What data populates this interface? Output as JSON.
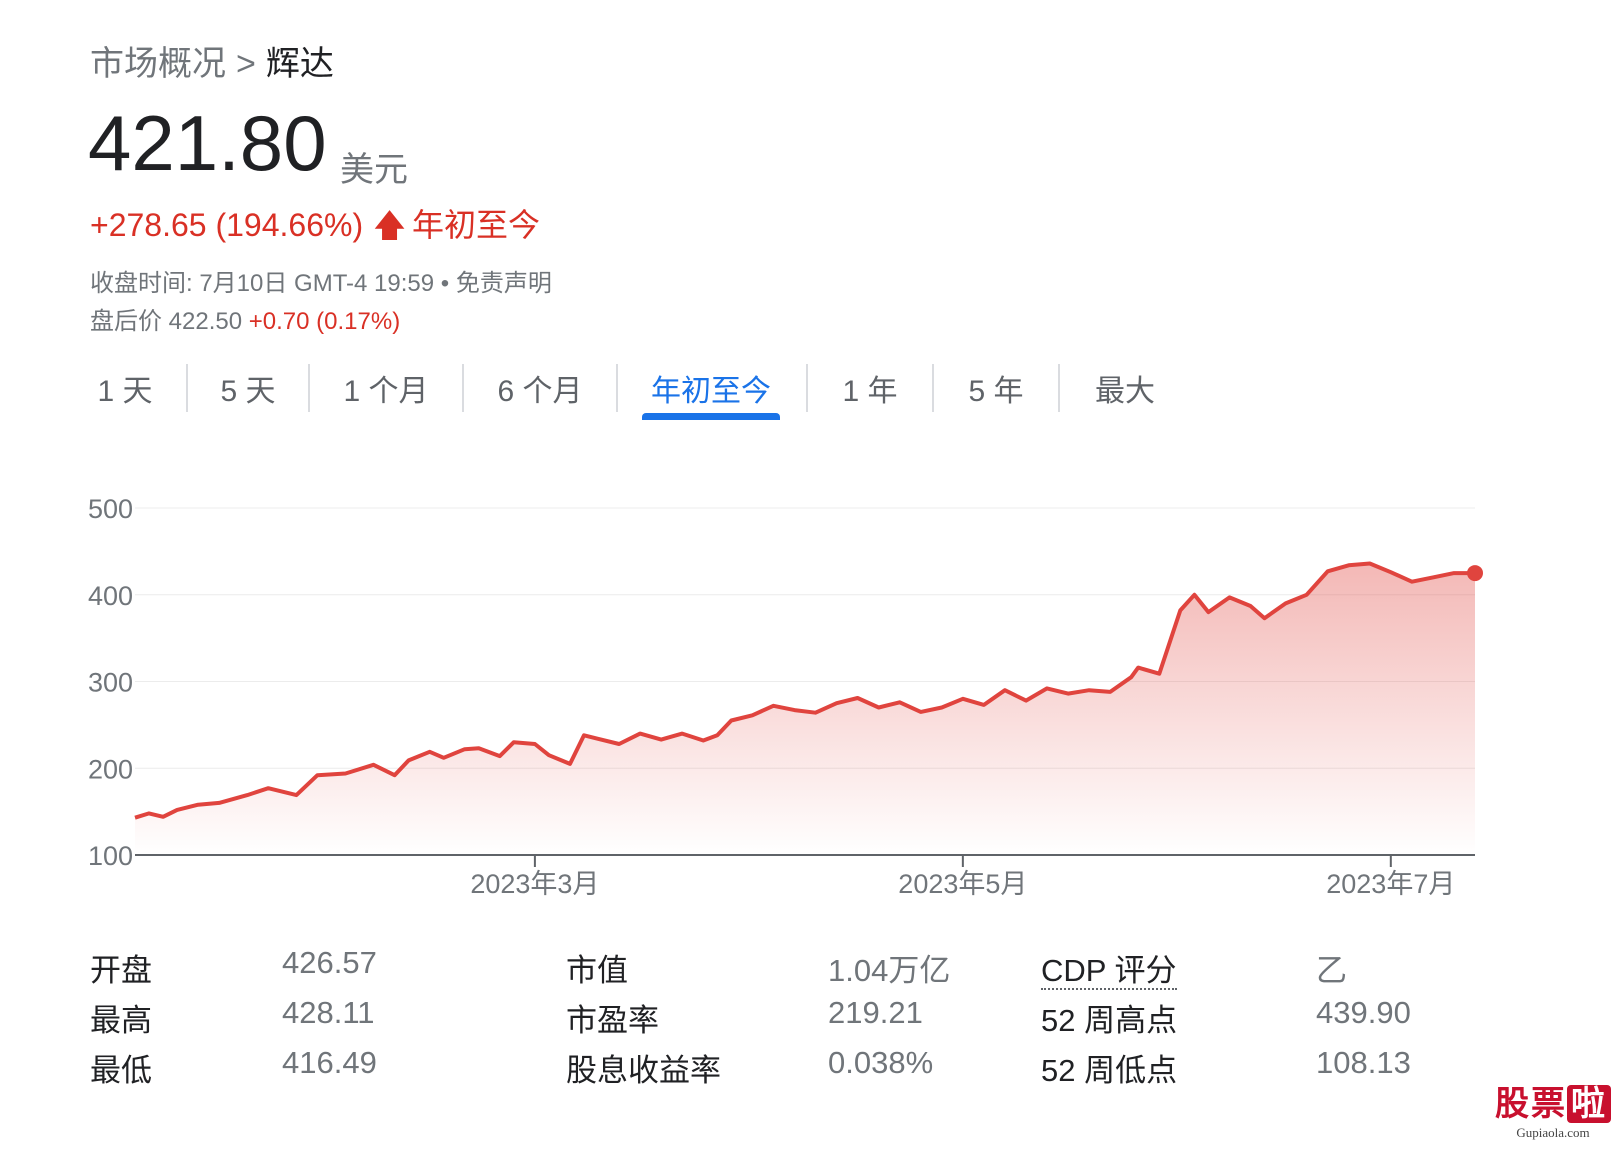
{
  "breadcrumb": {
    "parent": "市场概况",
    "separator": ">",
    "current": "辉达"
  },
  "quote": {
    "price": "421.80",
    "currency": "美元",
    "change": "+278.65 (194.66%)",
    "arrow": "🡅",
    "period": "年初至今",
    "close_time": "收盘时间: 7月10日 GMT-4 19:59 • 免责声明",
    "after_hours_label": "盘后价 422.50",
    "after_hours_change": "+0.70 (0.17%)"
  },
  "tabs": [
    {
      "label": "1 天",
      "active": false
    },
    {
      "label": "5 天",
      "active": false
    },
    {
      "label": "1 个月",
      "active": false
    },
    {
      "label": "6 个月",
      "active": false
    },
    {
      "label": "年初至今",
      "active": true
    },
    {
      "label": "1 年",
      "active": false
    },
    {
      "label": "5 年",
      "active": false
    },
    {
      "label": "最大",
      "active": false
    }
  ],
  "chart_data": {
    "type": "area",
    "ylim": [
      100,
      500
    ],
    "yticks": [
      100,
      200,
      300,
      400,
      500
    ],
    "ytick_labels": [
      "100",
      "200",
      "300",
      "400",
      "500"
    ],
    "xlim": [
      "2023-01-03",
      "2023-07-13"
    ],
    "xticks": [
      "2023-03-01",
      "2023-05-01",
      "2023-07-01"
    ],
    "xtick_labels": [
      "2023年3月",
      "2023年5月",
      "2023年7月"
    ],
    "grid": true,
    "line_color": "#e0443e",
    "fill_color": "#e0443e",
    "x": [
      "2023-01-03",
      "2023-01-05",
      "2023-01-07",
      "2023-01-09",
      "2023-01-12",
      "2023-01-15",
      "2023-01-19",
      "2023-01-22",
      "2023-01-26",
      "2023-01-29",
      "2023-02-02",
      "2023-02-06",
      "2023-02-09",
      "2023-02-11",
      "2023-02-14",
      "2023-02-16",
      "2023-02-19",
      "2023-02-21",
      "2023-02-24",
      "2023-02-26",
      "2023-03-01",
      "2023-03-03",
      "2023-03-06",
      "2023-03-08",
      "2023-03-10",
      "2023-03-13",
      "2023-03-16",
      "2023-03-19",
      "2023-03-22",
      "2023-03-25",
      "2023-03-27",
      "2023-03-29",
      "2023-04-01",
      "2023-04-04",
      "2023-04-07",
      "2023-04-10",
      "2023-04-13",
      "2023-04-16",
      "2023-04-19",
      "2023-04-22",
      "2023-04-25",
      "2023-04-28",
      "2023-05-01",
      "2023-05-04",
      "2023-05-07",
      "2023-05-10",
      "2023-05-13",
      "2023-05-16",
      "2023-05-19",
      "2023-05-22",
      "2023-05-25",
      "2023-05-26",
      "2023-05-29",
      "2023-06-01",
      "2023-06-03",
      "2023-06-05",
      "2023-06-08",
      "2023-06-11",
      "2023-06-13",
      "2023-06-16",
      "2023-06-19",
      "2023-06-22",
      "2023-06-25",
      "2023-06-28",
      "2023-07-01",
      "2023-07-04",
      "2023-07-07",
      "2023-07-10",
      "2023-07-13"
    ],
    "values": [
      143,
      148,
      144,
      152,
      158,
      160,
      169,
      177,
      169,
      192,
      194,
      204,
      192,
      209,
      219,
      212,
      222,
      223,
      214,
      230,
      228,
      215,
      205,
      238,
      234,
      228,
      240,
      233,
      240,
      232,
      238,
      255,
      261,
      272,
      267,
      264,
      275,
      281,
      270,
      276,
      265,
      270,
      280,
      273,
      290,
      278,
      292,
      286,
      290,
      288,
      305,
      316,
      309,
      382,
      400,
      380,
      397,
      387,
      373,
      390,
      400,
      427,
      434,
      436,
      426,
      415,
      420,
      425,
      425
    ]
  },
  "stats": [
    {
      "label": "开盘",
      "value": "426.57"
    },
    {
      "label": "最高",
      "value": "428.11"
    },
    {
      "label": "最低",
      "value": "416.49"
    },
    {
      "label": "市值",
      "value": "1.04万亿"
    },
    {
      "label": "市盈率",
      "value": "219.21"
    },
    {
      "label": "股息收益率",
      "value": "0.038%"
    },
    {
      "label": "CDP 评分",
      "value": "乙"
    },
    {
      "label": "52 周高点",
      "value": "439.90"
    },
    {
      "label": "52 周低点",
      "value": "108.13"
    }
  ],
  "watermark": {
    "main": "股票",
    "last": "啦",
    "sub": "Gupiaola.com"
  }
}
